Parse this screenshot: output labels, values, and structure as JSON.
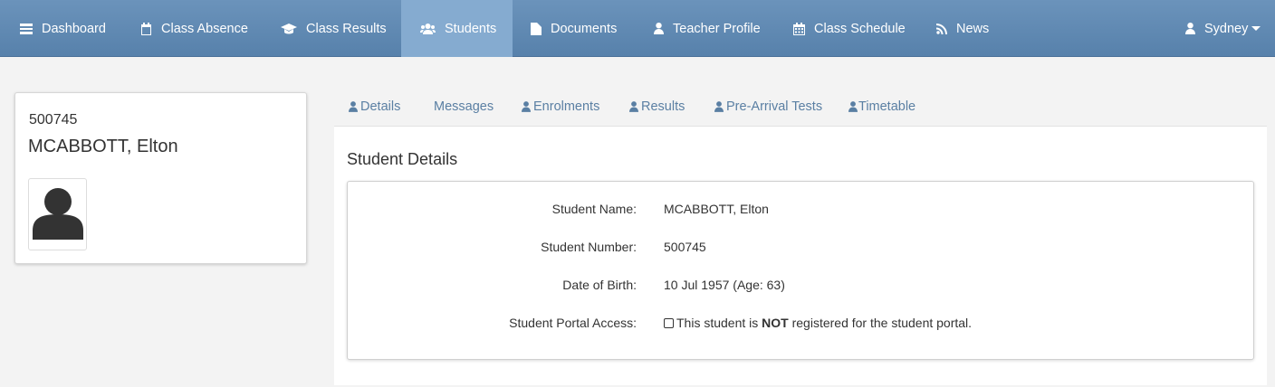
{
  "nav": {
    "items": [
      {
        "label": "Dashboard",
        "icon": "dashboard-icon"
      },
      {
        "label": "Class Absence",
        "icon": "calendar-icon"
      },
      {
        "label": "Class Results",
        "icon": "graduation-cap-icon"
      },
      {
        "label": "Students",
        "icon": "users-icon"
      },
      {
        "label": "Documents",
        "icon": "document-icon"
      },
      {
        "label": "Teacher Profile",
        "icon": "user-icon"
      },
      {
        "label": "Class Schedule",
        "icon": "calendar-grid-icon"
      },
      {
        "label": "News",
        "icon": "rss-icon"
      }
    ],
    "user_menu": {
      "label": "Sydney",
      "icon": "user-icon"
    },
    "active": "Students",
    "colors": {
      "bar": "#5f88b1",
      "active": "#85abd0"
    }
  },
  "profile": {
    "number": "500745",
    "name": "MCABBOTT, Elton",
    "avatar_icon": "user-silhouette-icon"
  },
  "tabs": [
    {
      "label": "Details",
      "icon": "user-icon"
    },
    {
      "label": "Messages",
      "icon": ""
    },
    {
      "label": "Enrolments",
      "icon": "user-icon"
    },
    {
      "label": "Results",
      "icon": "user-icon"
    },
    {
      "label": "Pre-Arrival Tests",
      "icon": "user-icon"
    },
    {
      "label": "Timetable",
      "icon": "user-icon"
    }
  ],
  "details": {
    "title": "Student Details",
    "rows": [
      {
        "label": "Student Name:",
        "value": "MCABBOTT, Elton"
      },
      {
        "label": "Student Number:",
        "value": "500745"
      },
      {
        "label": "Date of Birth:",
        "value": "10 Jul 1957 (Age: 63)"
      },
      {
        "label": "Student Portal Access:",
        "value_prefix": "This student is ",
        "value_bold": "NOT",
        "value_suffix": " registered for the student portal."
      }
    ]
  }
}
